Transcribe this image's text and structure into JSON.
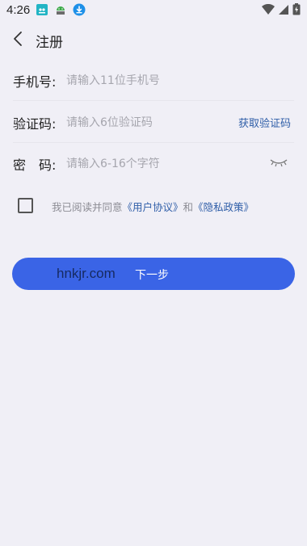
{
  "status_bar": {
    "time": "4:26",
    "app_icons": [
      "hero-app-icon",
      "android-icon",
      "download-icon"
    ],
    "right_icons": [
      "wifi-icon",
      "signal-icon",
      "battery-icon"
    ]
  },
  "header": {
    "back_icon": "chevron-left-icon",
    "title": "注册"
  },
  "form": {
    "phone": {
      "label": "手机号:",
      "placeholder": "请输入11位手机号",
      "value": ""
    },
    "code": {
      "label": "验证码:",
      "placeholder": "请输入6位验证码",
      "value": "",
      "get_code_label": "获取验证码"
    },
    "password": {
      "label": "密　码:",
      "placeholder": "请输入6-16个字符",
      "value": "",
      "toggle_icon": "eye-closed-icon"
    }
  },
  "agreement": {
    "checked": false,
    "prefix": "我已阅读并同意",
    "user_agreement": "《用户协议》",
    "connector": "和",
    "privacy_policy": "《隐私政策》"
  },
  "next_button": {
    "label": "下一步",
    "watermark": "hnkjr.com",
    "color": "#3A64E6"
  }
}
